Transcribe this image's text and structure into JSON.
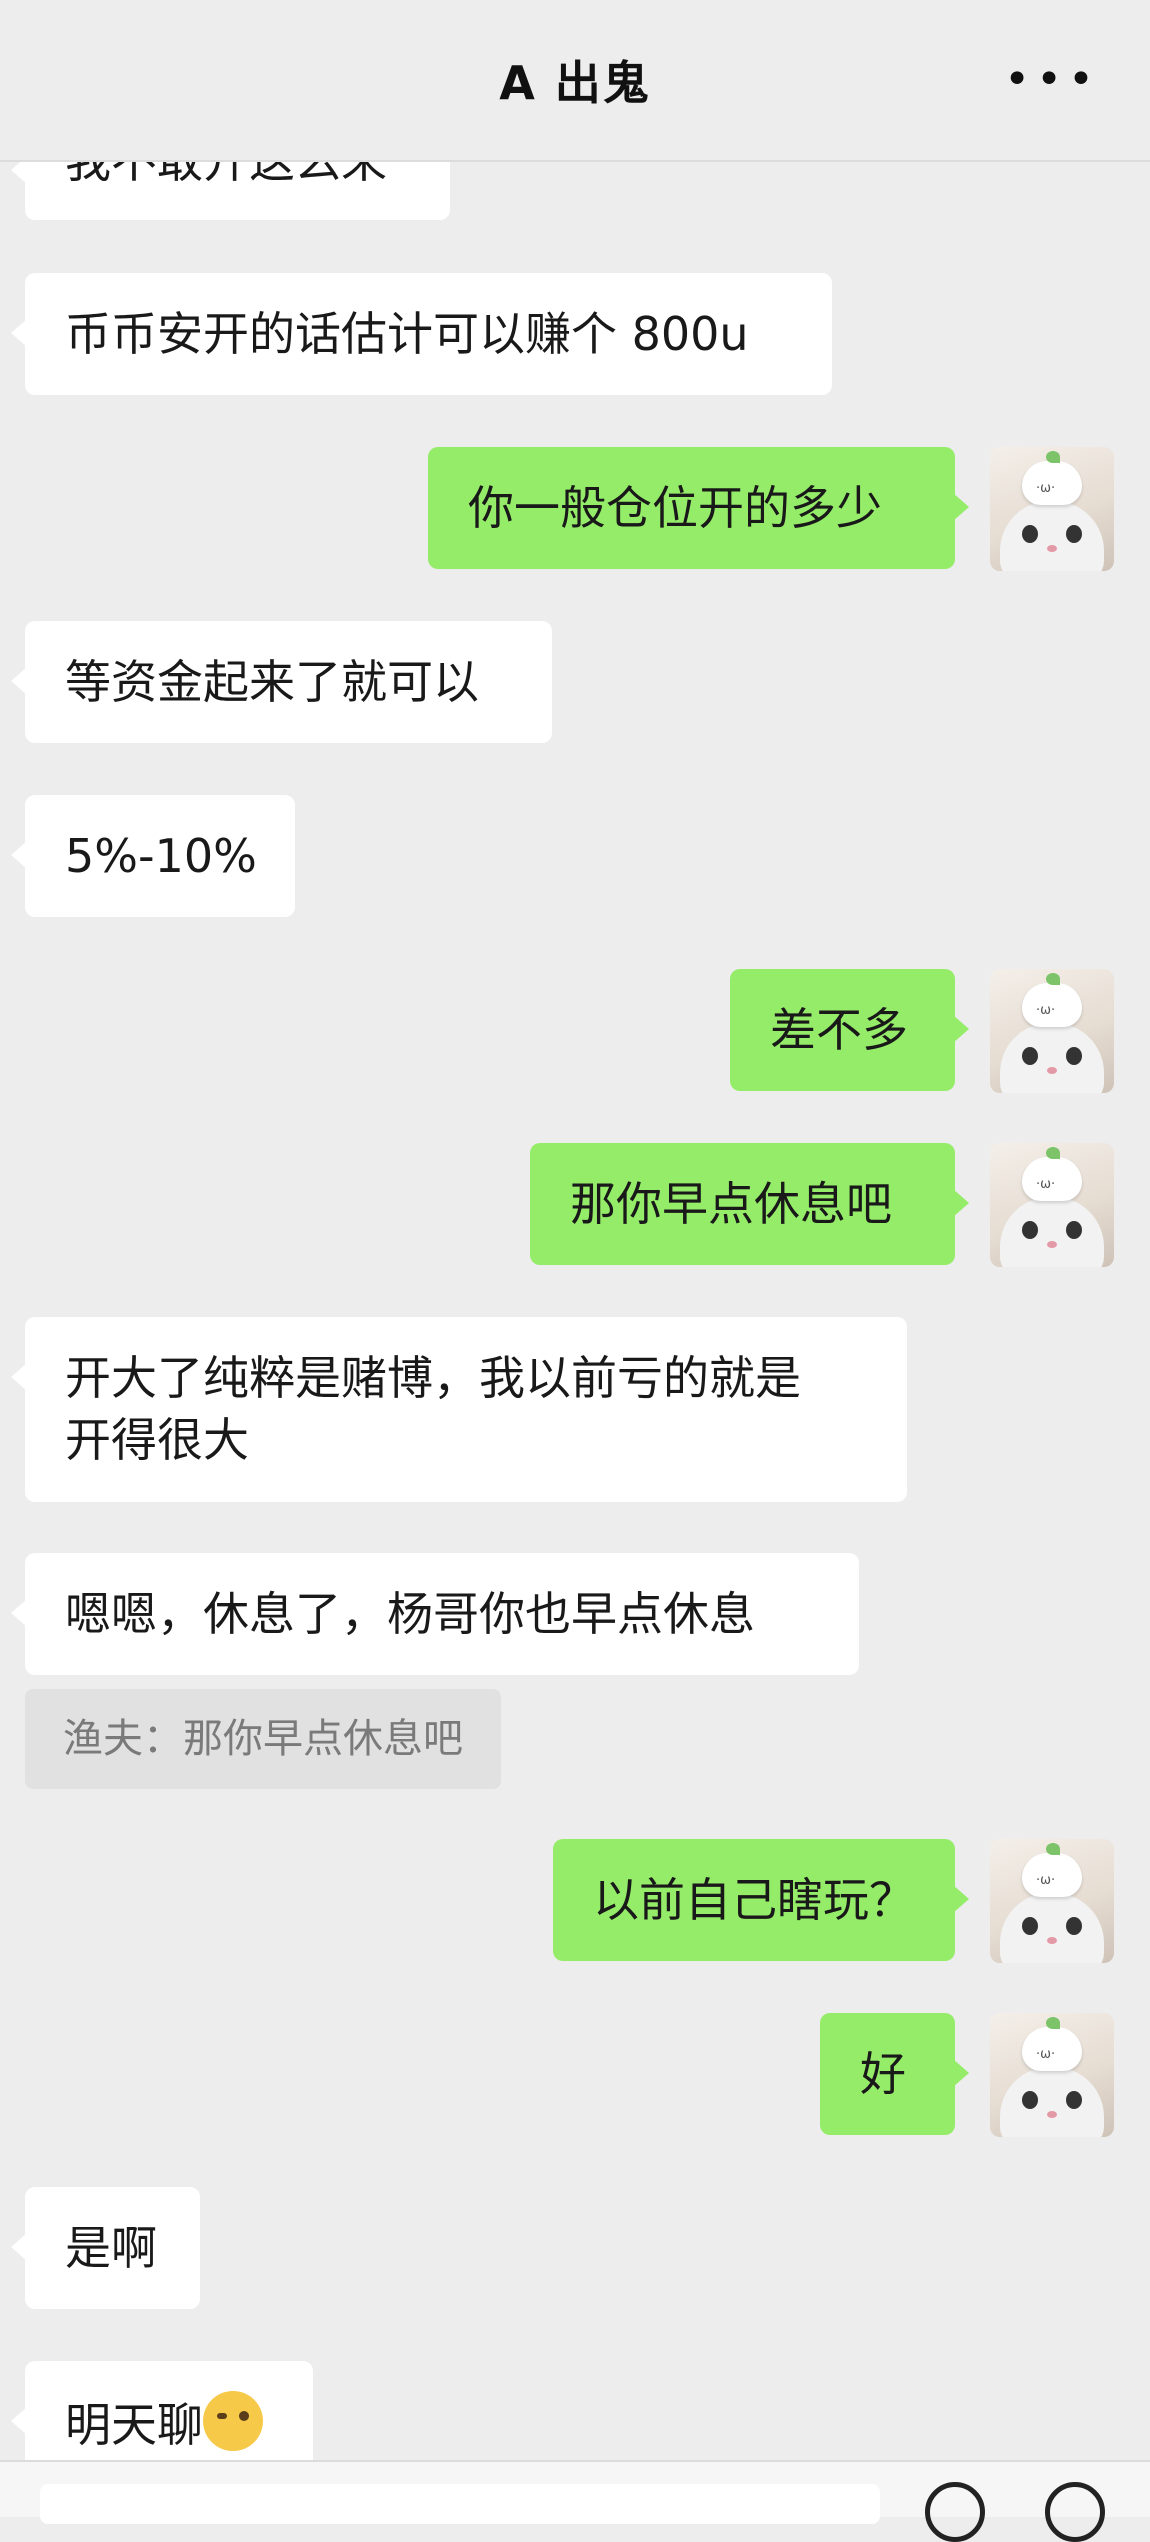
{
  "header": {
    "title": "A 出鬼",
    "more_label": "•••"
  },
  "messages": [
    {
      "side": "left",
      "text": "我不敢开这么来"
    },
    {
      "side": "left",
      "text": "币币安开的话估计可以赚个 800u"
    },
    {
      "side": "right",
      "text": "你一般仓位开的多少"
    },
    {
      "side": "left",
      "text": "等资金起来了就可以"
    },
    {
      "side": "left",
      "text": "5%-10%"
    },
    {
      "side": "right",
      "text": "差不多"
    },
    {
      "side": "right",
      "text": "那你早点休息吧"
    },
    {
      "side": "left",
      "text": "开大了纯粹是赌博，我以前亏的就是\n开得很大"
    },
    {
      "side": "left",
      "text": "嗯嗯，休息了，杨哥你也早点休息"
    },
    {
      "side": "right",
      "text": "以前自己瞎玩？"
    },
    {
      "side": "right",
      "text": "好"
    },
    {
      "side": "left",
      "text": "是啊"
    },
    {
      "side": "left",
      "text": "明天聊"
    }
  ],
  "quote": {
    "text": "渔夫：那你早点休息吧"
  },
  "avatar": {
    "icon": "cat-avatar-icon"
  },
  "colors": {
    "background": "#ededed",
    "self_bubble": "#95ec69",
    "other_bubble": "#ffffff"
  }
}
